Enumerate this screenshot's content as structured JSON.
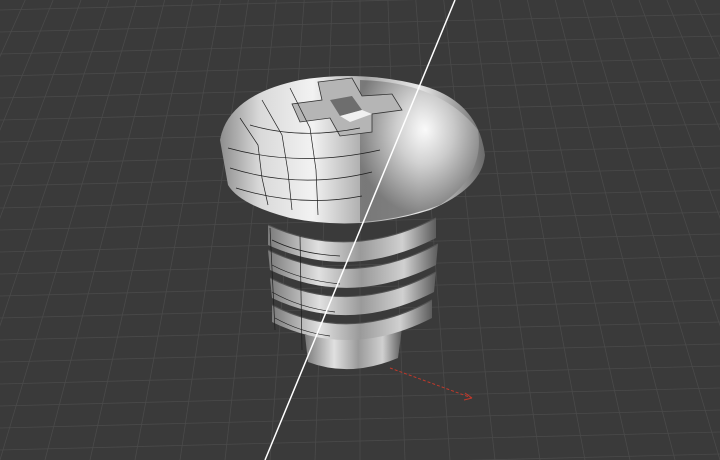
{
  "viewport": {
    "background_color": "#3a3a3a",
    "grid_color": "#4a4a4a",
    "grid_major_color": "#555555",
    "x_axis_color": "#c0392b",
    "object_name": "pan-head-screw",
    "view_modes": [
      "wireframe-overlay",
      "smooth-shaded"
    ],
    "comparison_divider_color": "#ffffff",
    "corner_label": "",
    "icons": [
      "comparison-slider-icon"
    ]
  }
}
